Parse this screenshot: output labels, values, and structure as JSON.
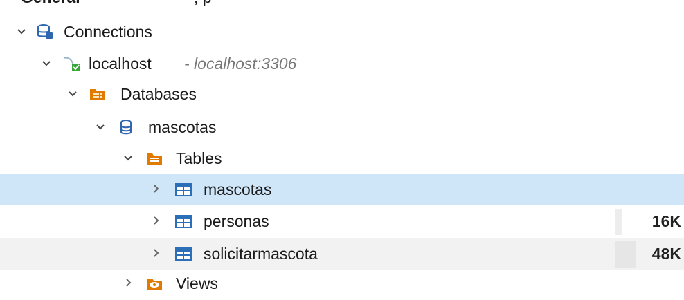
{
  "tree": {
    "top_partial": {
      "label": "General",
      "extra": ", p"
    },
    "connections": {
      "label": "Connections"
    },
    "host": {
      "label": "localhost",
      "detail": "- localhost:3306"
    },
    "databases": {
      "label": "Databases"
    },
    "schema": {
      "label": "mascotas"
    },
    "tables": {
      "label": "Tables",
      "items": [
        {
          "label": "mascotas",
          "size": "",
          "selected": true
        },
        {
          "label": "personas",
          "size": "16K",
          "size_fraction": 0.35
        },
        {
          "label": "solicitarmascota",
          "size": "48K",
          "size_fraction": 1.0
        }
      ]
    },
    "views": {
      "label": "Views"
    }
  },
  "colors": {
    "selection": "#cfe5f8",
    "folder_orange": "#e07b00",
    "table_blue": "#2b6fb8",
    "db_blue": "#2f66b0"
  }
}
